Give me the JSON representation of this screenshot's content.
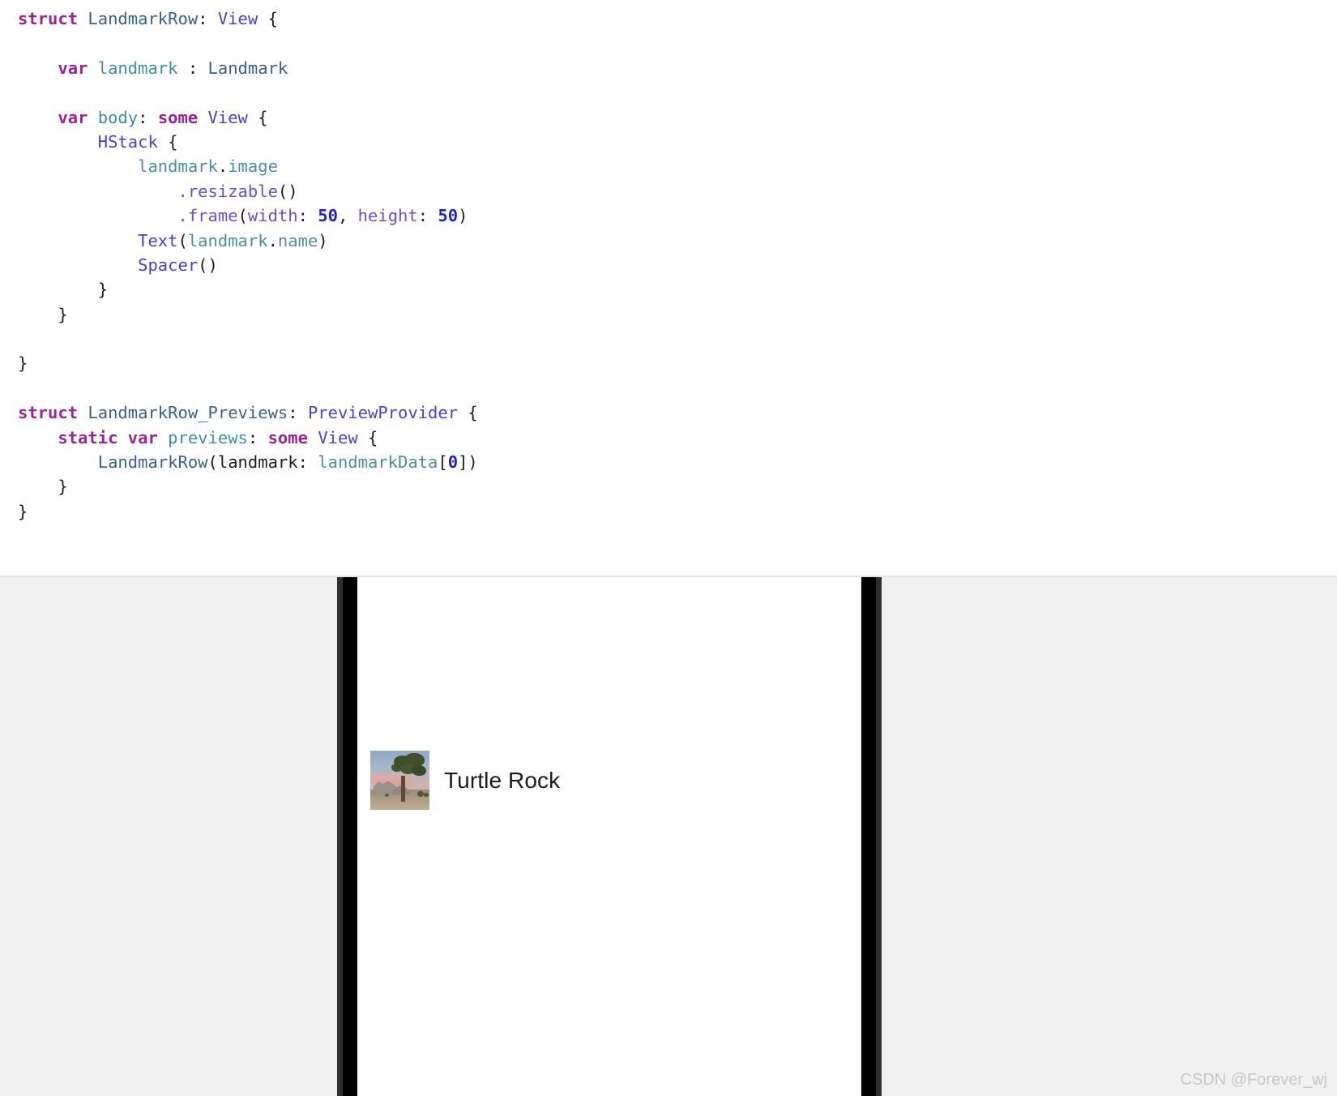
{
  "editor": {
    "language": "swift",
    "code_lines": [
      [
        {
          "t": "struct ",
          "c": "kw"
        },
        {
          "t": "LandmarkRow",
          "c": "type"
        },
        {
          "t": ": ",
          "c": "plain"
        },
        {
          "t": "View",
          "c": "proto"
        },
        {
          "t": " {",
          "c": "plain"
        }
      ],
      [],
      [
        {
          "t": "    ",
          "c": "plain"
        },
        {
          "t": "var ",
          "c": "kw"
        },
        {
          "t": "landmark",
          "c": "prop"
        },
        {
          "t": " : ",
          "c": "plain"
        },
        {
          "t": "Landmark",
          "c": "type"
        }
      ],
      [],
      [
        {
          "t": "    ",
          "c": "plain"
        },
        {
          "t": "var ",
          "c": "kw"
        },
        {
          "t": "body",
          "c": "prop"
        },
        {
          "t": ": ",
          "c": "plain"
        },
        {
          "t": "some ",
          "c": "kw"
        },
        {
          "t": "View",
          "c": "proto"
        },
        {
          "t": " {",
          "c": "plain"
        }
      ],
      [
        {
          "t": "        ",
          "c": "plain"
        },
        {
          "t": "HStack",
          "c": "proto"
        },
        {
          "t": " {",
          "c": "plain"
        }
      ],
      [
        {
          "t": "            ",
          "c": "plain"
        },
        {
          "t": "landmark",
          "c": "member"
        },
        {
          "t": ".",
          "c": "plain"
        },
        {
          "t": "image",
          "c": "member"
        }
      ],
      [
        {
          "t": "                ",
          "c": "plain"
        },
        {
          "t": ".resizable",
          "c": "method"
        },
        {
          "t": "()",
          "c": "plain"
        }
      ],
      [
        {
          "t": "                ",
          "c": "plain"
        },
        {
          "t": ".frame",
          "c": "method"
        },
        {
          "t": "(",
          "c": "plain"
        },
        {
          "t": "width",
          "c": "label"
        },
        {
          "t": ": ",
          "c": "plain"
        },
        {
          "t": "50",
          "c": "num"
        },
        {
          "t": ", ",
          "c": "plain"
        },
        {
          "t": "height",
          "c": "label"
        },
        {
          "t": ": ",
          "c": "plain"
        },
        {
          "t": "50",
          "c": "num"
        },
        {
          "t": ")",
          "c": "plain"
        }
      ],
      [
        {
          "t": "            ",
          "c": "plain"
        },
        {
          "t": "Text",
          "c": "proto"
        },
        {
          "t": "(",
          "c": "plain"
        },
        {
          "t": "landmark",
          "c": "member"
        },
        {
          "t": ".",
          "c": "plain"
        },
        {
          "t": "name",
          "c": "member"
        },
        {
          "t": ")",
          "c": "plain"
        }
      ],
      [
        {
          "t": "            ",
          "c": "plain"
        },
        {
          "t": "Spacer",
          "c": "proto"
        },
        {
          "t": "()",
          "c": "plain"
        }
      ],
      [
        {
          "t": "        }",
          "c": "plain"
        }
      ],
      [
        {
          "t": "    }",
          "c": "plain"
        }
      ],
      [],
      [
        {
          "t": "}",
          "c": "plain"
        }
      ],
      [],
      [
        {
          "t": "struct ",
          "c": "kw"
        },
        {
          "t": "LandmarkRow_Previews",
          "c": "type"
        },
        {
          "t": ": ",
          "c": "plain"
        },
        {
          "t": "PreviewProvider",
          "c": "proto"
        },
        {
          "t": " {",
          "c": "plain"
        }
      ],
      [
        {
          "t": "    ",
          "c": "plain"
        },
        {
          "t": "static ",
          "c": "kw"
        },
        {
          "t": "var ",
          "c": "kw"
        },
        {
          "t": "previews",
          "c": "prop"
        },
        {
          "t": ": ",
          "c": "plain"
        },
        {
          "t": "some ",
          "c": "kw"
        },
        {
          "t": "View",
          "c": "proto"
        },
        {
          "t": " {",
          "c": "plain"
        }
      ],
      [
        {
          "t": "        ",
          "c": "plain"
        },
        {
          "t": "LandmarkRow",
          "c": "type"
        },
        {
          "t": "(landmark: ",
          "c": "plain"
        },
        {
          "t": "landmarkData",
          "c": "member"
        },
        {
          "t": "[",
          "c": "plain"
        },
        {
          "t": "0",
          "c": "num"
        },
        {
          "t": "])",
          "c": "plain"
        }
      ],
      [
        {
          "t": "    }",
          "c": "plain"
        }
      ],
      [
        {
          "t": "}",
          "c": "plain"
        }
      ]
    ]
  },
  "preview": {
    "device": {
      "bezel_color": "#000000",
      "bezel_edge_color": "#2e2e2e",
      "screen_color": "#ffffff"
    },
    "row": {
      "thumbnail_alt": "joshua-tree-landmark-photo",
      "name": "Turtle Rock"
    },
    "background_color": "#f1f1f1"
  },
  "watermark": {
    "text": "CSDN @Forever_wj",
    "color": "#c8c8c8"
  }
}
